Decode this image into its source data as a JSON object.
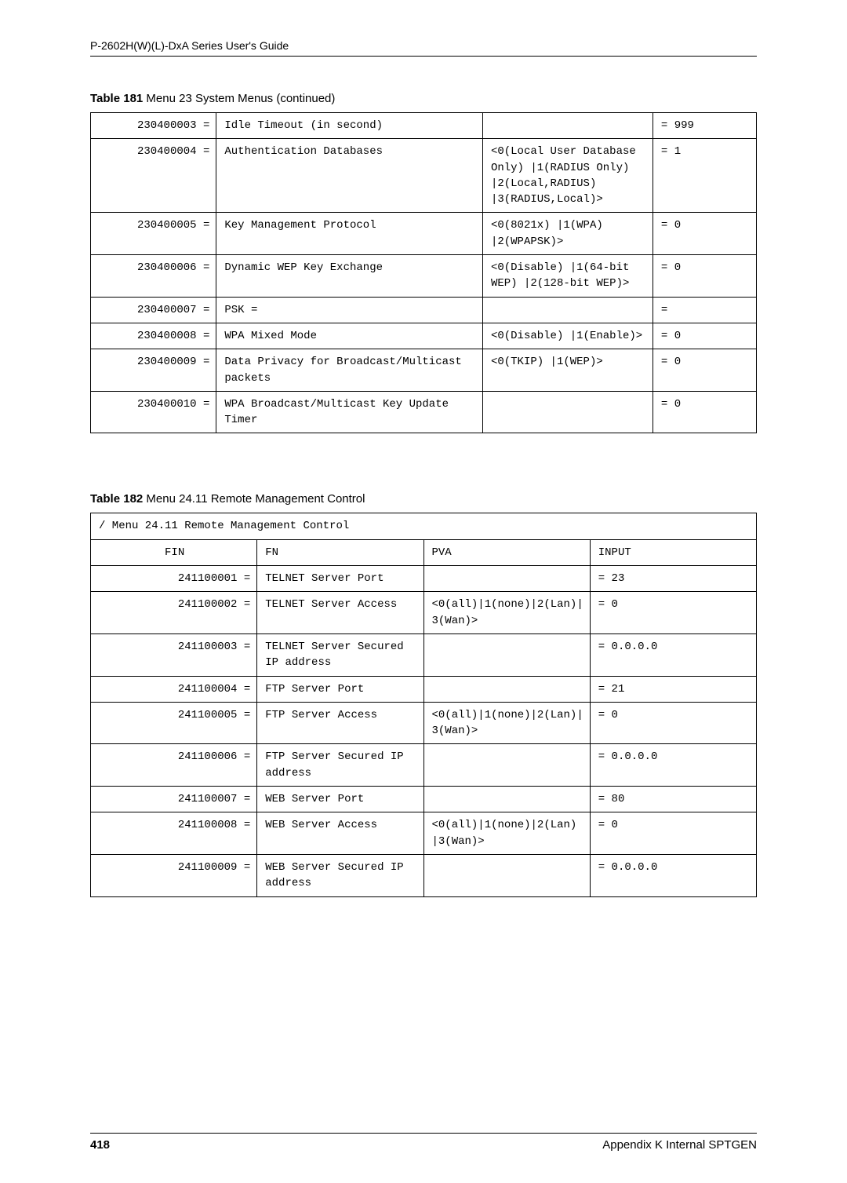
{
  "header": {
    "title": "P-2602H(W)(L)-DxA Series User's Guide"
  },
  "table1": {
    "caption_bold": "Table 181",
    "caption_rest": "   Menu 23 System Menus  (continued)",
    "rows": [
      {
        "c1": "230400003 =",
        "c2": "Idle Timeout (in second)",
        "c3": "",
        "c4": "= 999"
      },
      {
        "c1": "230400004 =",
        "c2": "Authentication Databases",
        "c3": "<0(Local User Database Only) |1(RADIUS Only) |2(Local,RADIUS) |3(RADIUS,Local)>",
        "c4": "= 1"
      },
      {
        "c1": "230400005 =",
        "c2": "Key Management Protocol",
        "c3": "<0(8021x) |1(WPA) |2(WPAPSK)>",
        "c4": "= 0"
      },
      {
        "c1": "230400006 =",
        "c2": "Dynamic WEP Key Exchange",
        "c3": "<0(Disable) |1(64-bit WEP) |2(128-bit WEP)>",
        "c4": "= 0"
      },
      {
        "c1": "230400007 =",
        "c2": "PSK  =",
        "c3": "",
        "c4": "="
      },
      {
        "c1": "230400008 =",
        "c2": "WPA Mixed Mode",
        "c3": "<0(Disable) |1(Enable)>",
        "c4": "= 0"
      },
      {
        "c1": "230400009 =",
        "c2": "Data Privacy for Broadcast/Multicast packets",
        "c3": "<0(TKIP) |1(WEP)>",
        "c4": "= 0"
      },
      {
        "c1": "230400010 =",
        "c2": "WPA Broadcast/Multicast Key Update Timer",
        "c3": "",
        "c4": "= 0"
      }
    ]
  },
  "table2": {
    "caption_bold": "Table 182",
    "caption_rest": "   Menu 24.11 Remote Management Control",
    "title_row": "/ Menu 24.11 Remote Management Control",
    "header": {
      "c1": "FIN",
      "c2": "FN",
      "c3": "PVA",
      "c4": "INPUT"
    },
    "rows": [
      {
        "c1": "241100001 =",
        "c2": "TELNET Server Port",
        "c3": "",
        "c4": "= 23"
      },
      {
        "c1": "241100002 =",
        "c2": "TELNET Server Access",
        "c3": "<0(all)|1(none)|2(Lan)|3(Wan)>",
        "c4": "= 0"
      },
      {
        "c1": "241100003 =",
        "c2": "TELNET Server Secured IP address",
        "c3": "",
        "c4": "= 0.0.0.0"
      },
      {
        "c1": "241100004 =",
        "c2": "FTP Server Port",
        "c3": "",
        "c4": "= 21"
      },
      {
        "c1": "241100005 =",
        "c2": "FTP Server Access",
        "c3": "<0(all)|1(none)|2(Lan)|3(Wan)>",
        "c4": "= 0"
      },
      {
        "c1": "241100006 =",
        "c2": "FTP Server Secured IP address",
        "c3": "",
        "c4": "= 0.0.0.0"
      },
      {
        "c1": "241100007 =",
        "c2": "WEB Server Port",
        "c3": "",
        "c4": "= 80"
      },
      {
        "c1": "241100008 =",
        "c2": "WEB Server Access",
        "c3": "<0(all)|1(none)|2(Lan) |3(Wan)>",
        "c4": "= 0"
      },
      {
        "c1": "241100009 =",
        "c2": "WEB Server Secured IP address",
        "c3": "",
        "c4": "= 0.0.0.0"
      }
    ]
  },
  "footer": {
    "page": "418",
    "appendix": "Appendix K Internal SPTGEN"
  }
}
